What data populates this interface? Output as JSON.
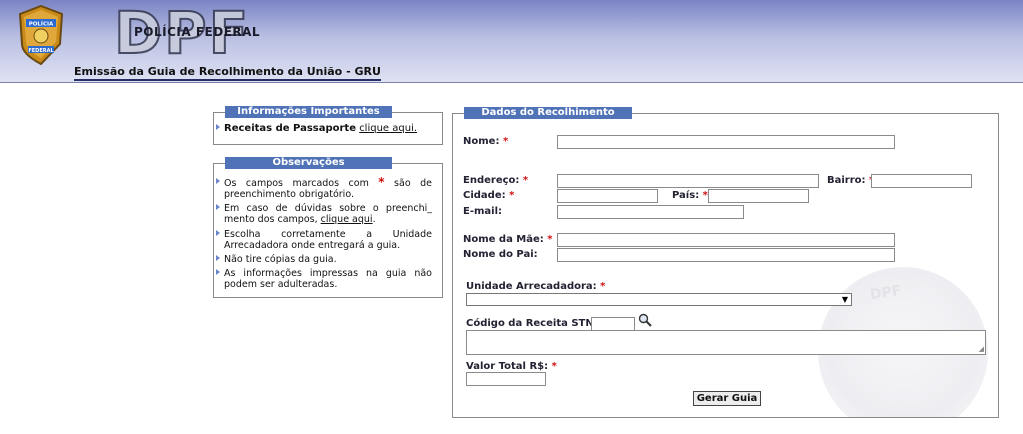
{
  "header": {
    "logo_top": "POLÍCIA",
    "logo_bottom": "FEDERAL",
    "big_title": "DPF",
    "sub_title": "POLÍCIA FEDERAL",
    "page_title": "Emissão da Guia de Recolhimento da União - GRU"
  },
  "info_box": {
    "legend": "Informações Importantes",
    "item_label": "Receitas de Passaporte",
    "item_link": "clique aqui."
  },
  "obs_box": {
    "legend": "Observações",
    "item1_a": "Os campos marcados com",
    "item1_star": "*",
    "item1_b": "são de preenchimento obrigatório.",
    "item2_a": "Em caso de dúvidas sobre o preenchi_ mento dos campos,",
    "item2_link": "clique aqui",
    "item2_b": ".",
    "item3": "Escolha corretamente a Unidade Arrecadadora onde entregará a guia.",
    "item4": "Não tire cópias da guia.",
    "item5": "As informações impressas na guia não podem ser adulteradas."
  },
  "form": {
    "legend": "Dados do Recolhimento",
    "required_mark": "*",
    "nome_label": "Nome:",
    "endereco_label": "Endereço:",
    "bairro_label": "Bairro:",
    "cidade_label": "Cidade:",
    "pais_label": "País:",
    "email_label": "E-mail:",
    "mae_label": "Nome da Mãe:",
    "pai_label": "Nome do Pai:",
    "unidade_label": "Unidade Arrecadadora:",
    "unidade_value": "",
    "codigo_label": "Código da Receita STN:",
    "valor_label": "Valor Total R$:",
    "submit_label": "Gerar Guia",
    "search_icon": "magnifier-icon",
    "watermark_text": "DPF"
  },
  "colors": {
    "legend_bg": "#5073b8",
    "required": "#d01010",
    "header_dark": "#7a84c4"
  }
}
